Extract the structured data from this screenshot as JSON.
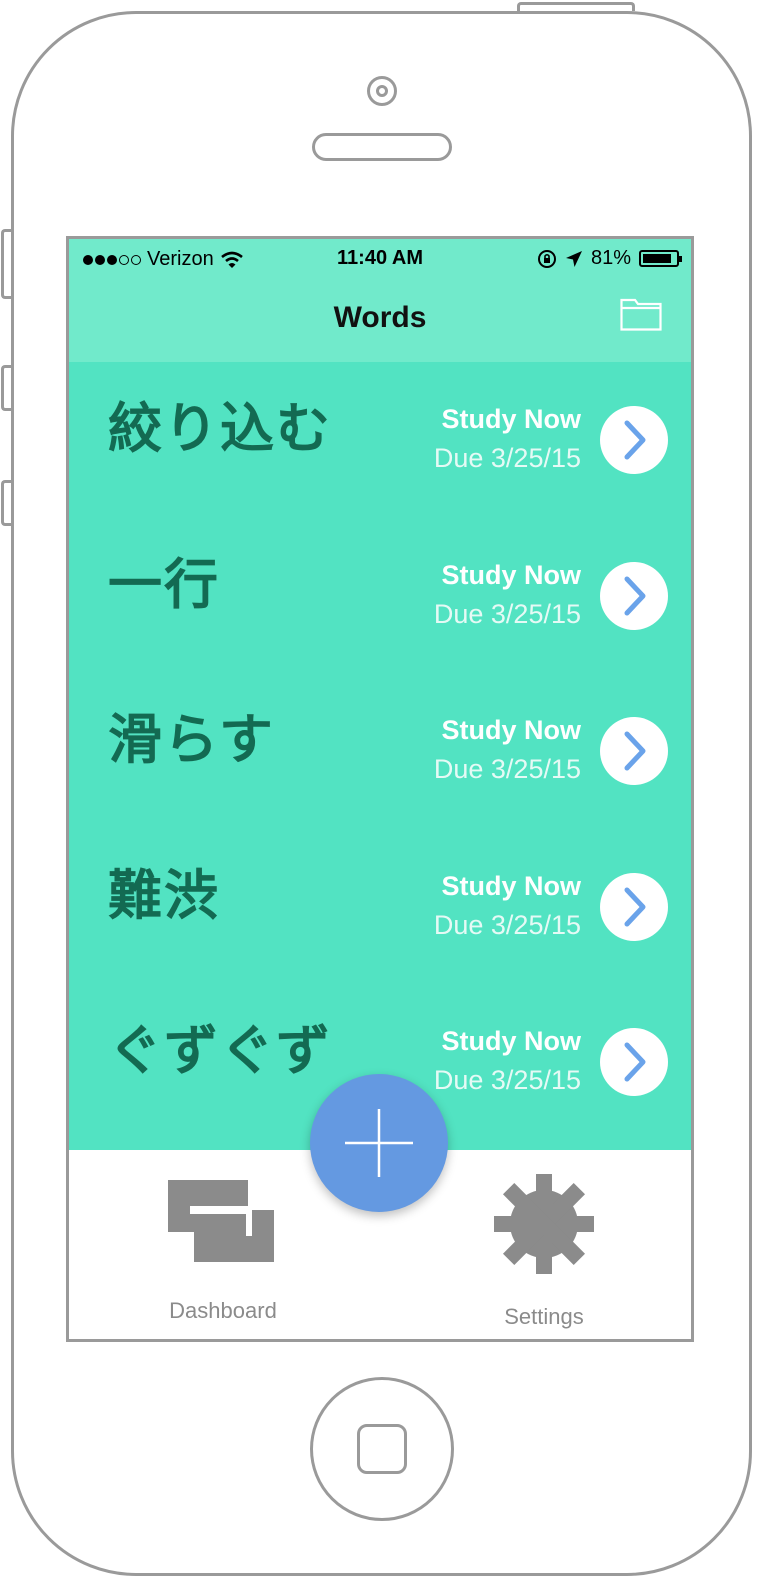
{
  "status_bar": {
    "carrier": "Verizon",
    "time": "11:40 AM",
    "battery": "81%",
    "battery_level": 0.81
  },
  "nav": {
    "title": "Words",
    "folder_icon": "folder-icon"
  },
  "words": [
    {
      "word": "絞り込む",
      "action": "Study Now",
      "due": "Due 3/25/15"
    },
    {
      "word": "一行",
      "action": "Study Now",
      "due": "Due 3/25/15"
    },
    {
      "word": "滑らす",
      "action": "Study Now",
      "due": "Due 3/25/15"
    },
    {
      "word": "難渋",
      "action": "Study Now",
      "due": "Due 3/25/15"
    },
    {
      "word": "ぐずぐず",
      "action": "Study Now",
      "due": "Due 3/25/15"
    }
  ],
  "tabbar": {
    "dashboard": "Dashboard",
    "settings": "Settings"
  },
  "colors": {
    "navbar": "#71eacb",
    "list_bg": "#52e3c2",
    "word_text": "#136a52",
    "fab": "#6499e1",
    "chevron": "#6aa3ea",
    "tab_icon": "#8b8b8b"
  }
}
